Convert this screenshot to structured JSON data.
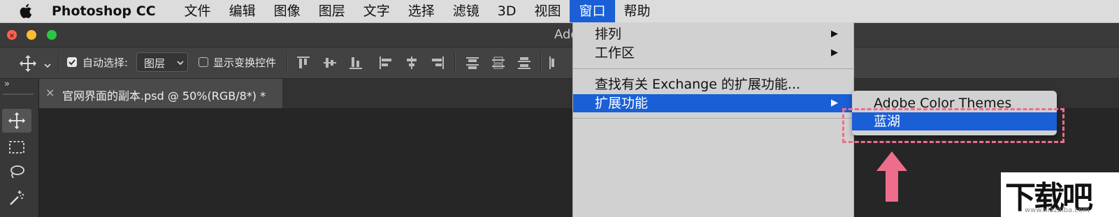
{
  "menubar": {
    "app_name": "Photoshop CC",
    "items": [
      "文件",
      "编辑",
      "图像",
      "图层",
      "文字",
      "选择",
      "滤镜",
      "3D",
      "视图",
      "窗口",
      "帮助"
    ],
    "active_item": "窗口"
  },
  "window": {
    "title_fragment": "Ado",
    "traffic_light_colors": [
      "#fe5f57",
      "#febc2e",
      "#28c840"
    ]
  },
  "options_bar": {
    "auto_select_label": "自动选择:",
    "auto_select_checked": true,
    "auto_select_value": "图层",
    "show_transform_label": "显示变换控件",
    "show_transform_checked": false
  },
  "document_tab": {
    "close_glyph": "×",
    "title": "官网界面的副本.psd @ 50%(RGB/8*) *"
  },
  "tools_panel": {
    "collapse_glyph": "»",
    "tools": [
      "move-tool",
      "marquee-tool",
      "lasso-tool",
      "magic-wand-tool"
    ]
  },
  "window_menu": {
    "items": [
      {
        "label": "排列",
        "has_submenu": true,
        "highlighted": false
      },
      {
        "label": "工作区",
        "has_submenu": true,
        "highlighted": false
      },
      {
        "label": "查找有关 Exchange 的扩展功能...",
        "has_submenu": false,
        "highlighted": false
      },
      {
        "label": "扩展功能",
        "has_submenu": true,
        "highlighted": true
      }
    ],
    "submenu_arrow": "▶"
  },
  "extensions_submenu": {
    "items": [
      {
        "label": "Adobe Color Themes",
        "highlighted": false
      },
      {
        "label": "蓝湖",
        "highlighted": true
      }
    ]
  },
  "annotation": {
    "color": "#ef6d8c"
  },
  "watermark": {
    "text": "下载吧",
    "url": "www.xiazaiba.com"
  },
  "colors": {
    "menu_highlight": "#1a5fd6",
    "menubar_bg": "#dcdcdc",
    "workspace_bg": "#262626"
  }
}
